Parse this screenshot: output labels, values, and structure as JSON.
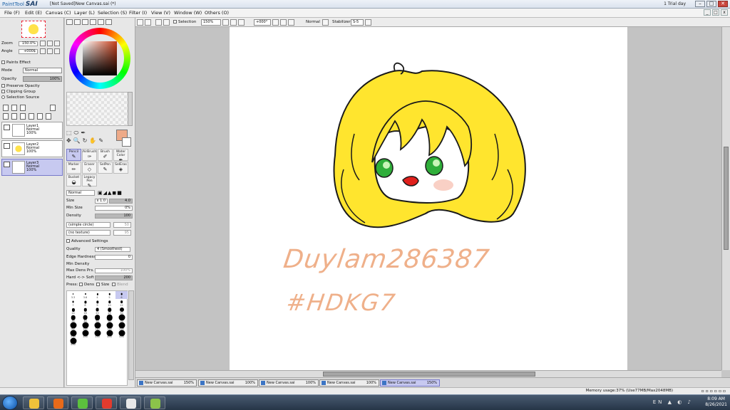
{
  "titlebar": {
    "app_name_prefix": "PaintTool",
    "app_name": "SAI",
    "document": "[Not Saved]New Canvas.sai (*)",
    "trial": "1 Trial day"
  },
  "menu": [
    "File (F)",
    "Edit (E)",
    "Canvas (C)",
    "Layer (L)",
    "Selection (S)",
    "Filter (I)",
    "View (V)",
    "Window (W)",
    "Others (O)"
  ],
  "navigator": {
    "zoom_label": "Zoom",
    "zoom_value": "150.0%",
    "angle_label": "Angle",
    "angle_value": "+000$"
  },
  "layer_props": {
    "paper_effect": "Paints Effect",
    "mode_label": "Mode",
    "mode_value": "Normal",
    "opacity_label": "Opacity",
    "opacity_value": "100%",
    "preserve_opacity": "Preserve Opacity",
    "clipping_group": "Clipping Group",
    "selection_source": "Selection Source"
  },
  "layers": [
    {
      "name": "Layer1",
      "mode": "Normal",
      "opacity": "100%",
      "selected": false
    },
    {
      "name": "Layer2",
      "mode": "Normal",
      "opacity": "100%",
      "selected": false
    },
    {
      "name": "Layer3",
      "mode": "Normal",
      "opacity": "100%",
      "selected": true
    }
  ],
  "colors": {
    "foreground": "#eeaa88",
    "background": "#ffffff",
    "accent": "#c7c9f0"
  },
  "brushes": [
    {
      "label": "Pencil",
      "icon": "pencil-icon",
      "selected": true
    },
    {
      "label": "AirBrush",
      "icon": "airbrush-icon",
      "selected": false
    },
    {
      "label": "Brush",
      "icon": "brush-icon",
      "selected": false
    },
    {
      "label": "Water Color",
      "icon": "watercolor-icon",
      "selected": false
    },
    {
      "label": "Marker",
      "icon": "marker-icon",
      "selected": false
    },
    {
      "label": "Eraser",
      "icon": "eraser-icon",
      "selected": false
    },
    {
      "label": "SelPen",
      "icon": "selpen-icon",
      "selected": false
    },
    {
      "label": "SelEras",
      "icon": "seleras-icon",
      "selected": false
    },
    {
      "label": "Bucket",
      "icon": "bucket-icon",
      "selected": false
    },
    {
      "label": "Legacy Pen",
      "icon": "legacypen-icon",
      "selected": false
    }
  ],
  "brush_settings": {
    "blend_mode": "Normal",
    "size_label": "Size",
    "size_mult": "x 1.0",
    "size_value": "4.0",
    "min_size_label": "Min Size",
    "min_size_value": "0%",
    "density_label": "Density",
    "density_value": "100",
    "shape": "(simple circle)",
    "shape_value": "50",
    "texture": "(no texture)",
    "texture_value": "95",
    "advanced": "Advanced Settings",
    "quality_label": "Quality",
    "quality_value": "4 (Smoothest)",
    "edge_label": "Edge Hardness",
    "edge_value": "0",
    "min_density_label": "Min Density",
    "max_dens_label": "Max Dens Prs.",
    "max_dens_value": "100%",
    "hard_soft_label": "Hard <-> Soft",
    "hard_soft_value": "200",
    "press_label": "Press:",
    "press_dens": "Dens",
    "press_size": "Size",
    "press_blend": "Blend"
  },
  "brush_sizes": [
    "3.3",
    "3.6",
    "4",
    "5",
    "6",
    "7",
    "8",
    "9",
    "10",
    "12",
    "14",
    "16",
    "20",
    "25",
    "30",
    "35",
    "40",
    "50",
    "60",
    "70",
    "80",
    "100",
    "120",
    "160",
    "200",
    "250",
    "300",
    "350",
    "400",
    "450",
    "500"
  ],
  "canvas_toolbar": {
    "selection_label": "Selection",
    "zoom": "150%",
    "angle": "+000°",
    "mode": "Normal",
    "stabilizer_label": "Stabilizer",
    "stabilizer_value": "S-5"
  },
  "artwork": {
    "handwriting_line1": "Duylam286387",
    "handwriting_line2": "#HDKG7"
  },
  "canvas_tabs": [
    {
      "name": "New Canvas.sai",
      "zoom": "150%",
      "selected": false
    },
    {
      "name": "New Canvas.sai",
      "zoom": "100%",
      "selected": false
    },
    {
      "name": "New Canvas.sai",
      "zoom": "100%",
      "selected": false
    },
    {
      "name": "New Canvas.sai",
      "zoom": "100%",
      "selected": false
    },
    {
      "name": "New Canvas.sai",
      "zoom": "150%",
      "selected": true
    }
  ],
  "status": {
    "memory": "Memory usage:37% (Use77MB/Max2048MB)"
  },
  "taskbar": {
    "apps": [
      {
        "icon": "explorer-icon",
        "color": "#f0c23a"
      },
      {
        "icon": "media-player-icon",
        "color": "#e86a1a"
      },
      {
        "icon": "app-green-icon",
        "color": "#5cc13d"
      },
      {
        "icon": "chrome-icon",
        "color": "#e33b2e"
      },
      {
        "icon": "app-paint-icon",
        "color": "#e8e8e8"
      },
      {
        "icon": "sai-icon",
        "color": "#8bc34a"
      }
    ],
    "lang": "EN",
    "time": "8:09 AM",
    "date": "8/26/2021"
  }
}
